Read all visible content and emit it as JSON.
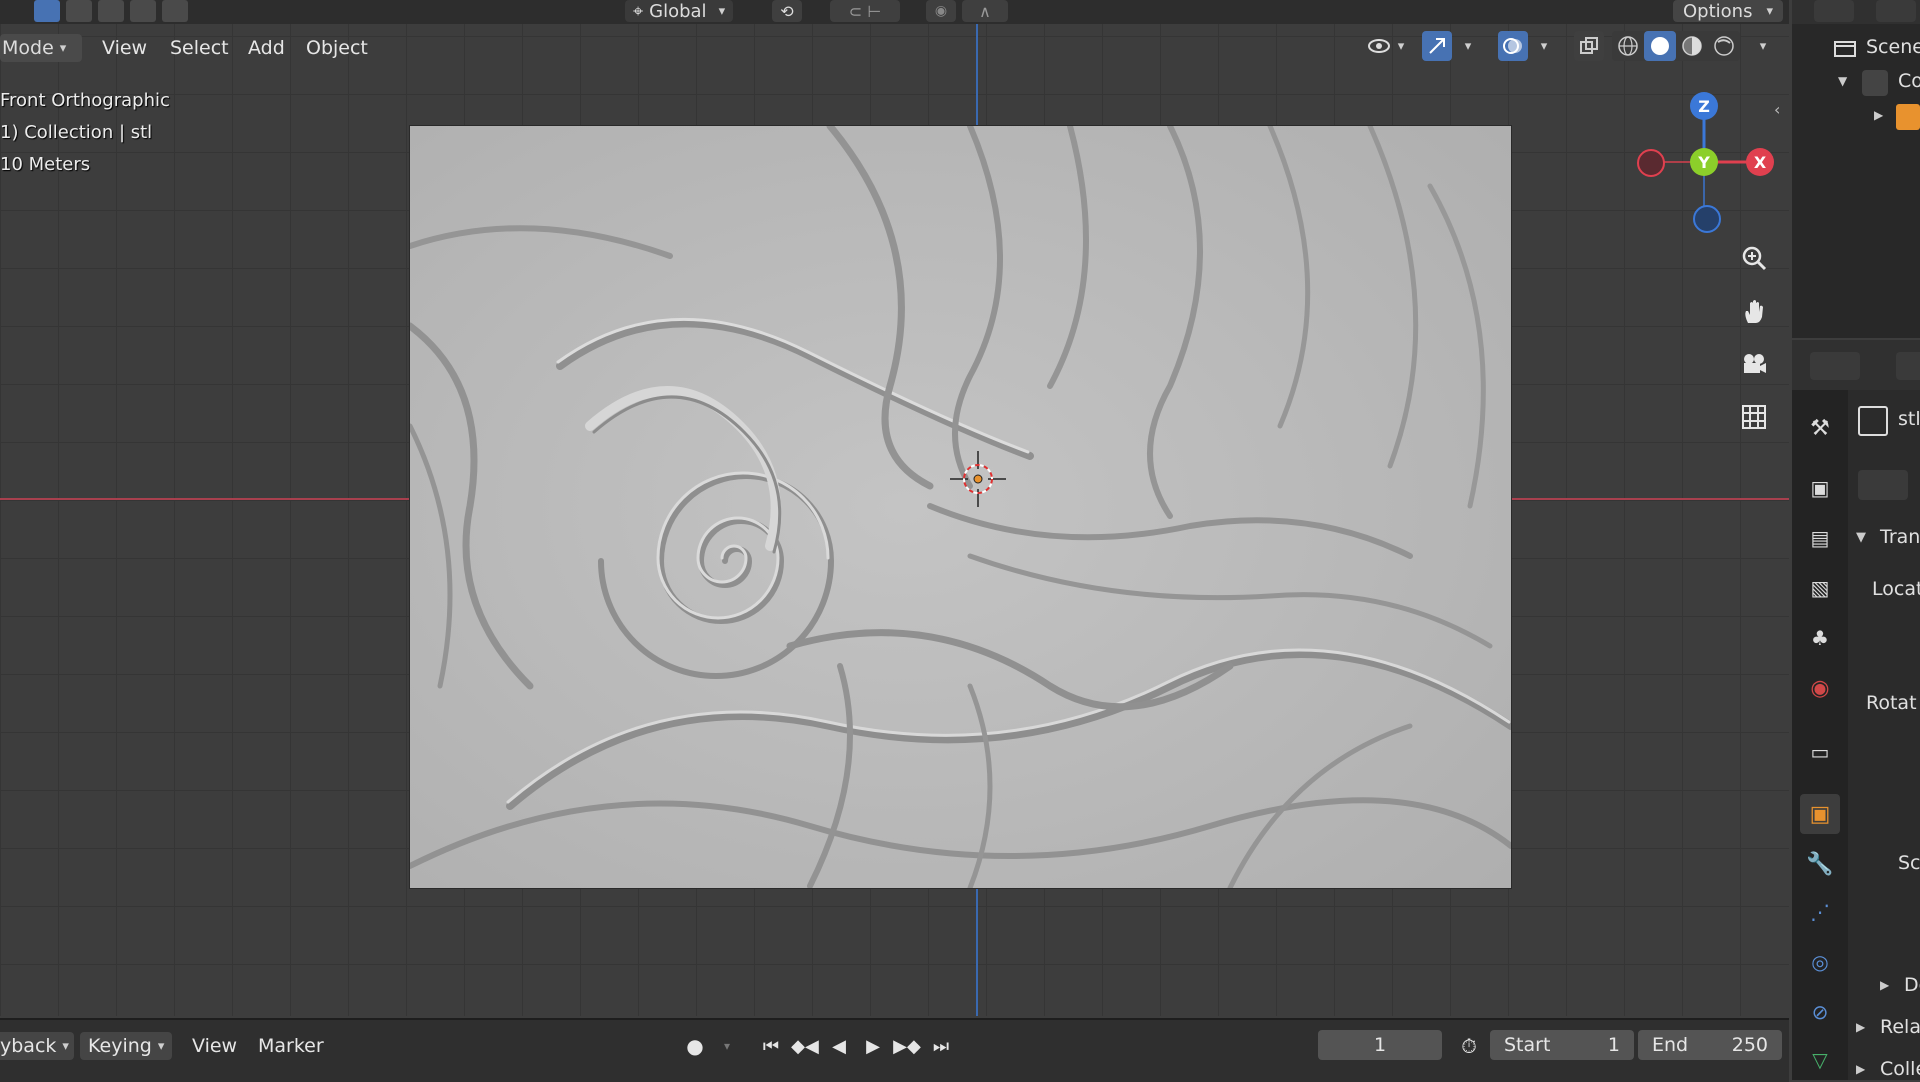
{
  "top_header": {
    "orientation_label": "Global",
    "options_label": "Options"
  },
  "viewport_header": {
    "mode_label": "Mode",
    "menus": [
      "View",
      "Select",
      "Add",
      "Object"
    ]
  },
  "viewport_info": {
    "view_name": "Front Orthographic",
    "collection_line": "1) Collection | stl",
    "scale_line": "10 Meters"
  },
  "gizmo": {
    "x": "X",
    "y": "Y",
    "z": "Z"
  },
  "outliner": {
    "rows": [
      "Scene",
      "Co"
    ]
  },
  "properties": {
    "object_name": "stl",
    "section_transform": "Tran",
    "location_label": "Locat",
    "rotation_label": "Rotat",
    "scale_label": "Sc",
    "delta_label": "De",
    "relations_label": "Rela",
    "collections_label": "Colle"
  },
  "timeline": {
    "playback_label": "yback",
    "keying_label": "Keying",
    "view_label": "View",
    "marker_label": "Marker",
    "current_frame": "1",
    "start_label": "Start",
    "start_value": "1",
    "end_label": "End",
    "end_value": "250"
  },
  "colors": {
    "accent_blue": "#4772b3",
    "axis_x_red": "#e0404f",
    "axis_y_green": "#8ccf2a",
    "axis_z_blue": "#3b78d8",
    "active_orange": "#e8922e"
  }
}
